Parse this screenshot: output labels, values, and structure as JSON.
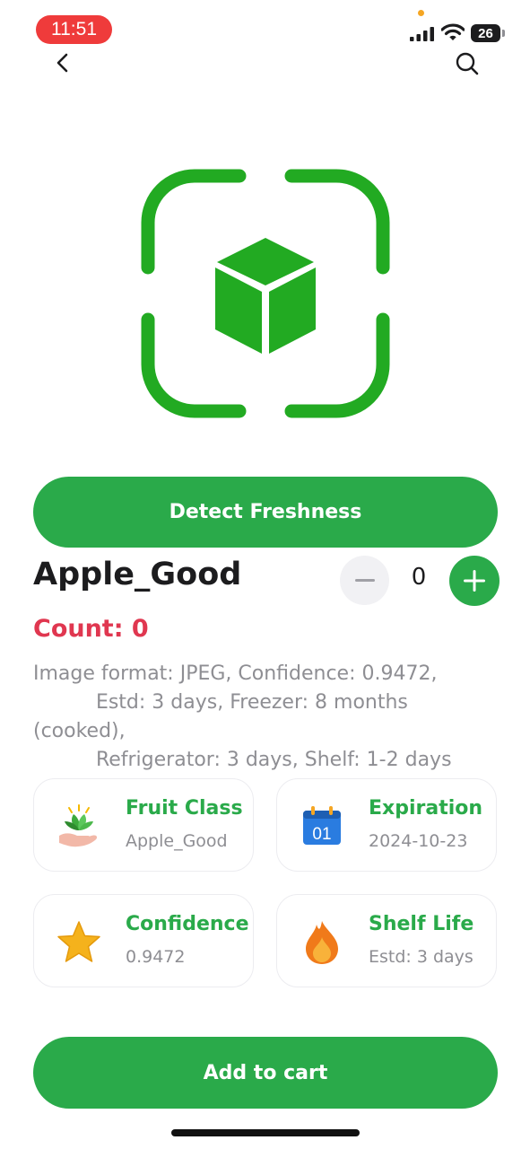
{
  "status_bar": {
    "time": "11:51",
    "battery": "26"
  },
  "header": {
    "back_icon": "chevron-left-icon",
    "search_icon": "search-icon"
  },
  "scanner": {
    "icon": "cube-scan-icon",
    "accent_color": "#22AA22"
  },
  "actions": {
    "detect_label": "Detect Freshness",
    "add_to_cart_label": "Add to cart"
  },
  "product": {
    "name": "Apple_Good",
    "quantity": "0",
    "count_label": "Count: 0",
    "description": "Image format: JPEG, Confidence: 0.9472,\n          Estd: 3 days, Freezer: 8 months (cooked),\n          Refrigerator: 3 days, Shelf: 1-2 days"
  },
  "cards": [
    {
      "title": "Fruit Class",
      "value": "Apple_Good",
      "icon": "sprout-hand-icon"
    },
    {
      "title": "Expiration",
      "value": "2024-10-23",
      "icon": "calendar-icon",
      "icon_text": "01"
    },
    {
      "title": "Confidence",
      "value": "0.9472",
      "icon": "star-icon"
    },
    {
      "title": "Shelf Life",
      "value": "Estd: 3 days",
      "icon": "flame-icon"
    }
  ],
  "colors": {
    "primary_green": "#2AAA4A",
    "count_red": "#E03750",
    "muted_text": "#8E8E93"
  }
}
